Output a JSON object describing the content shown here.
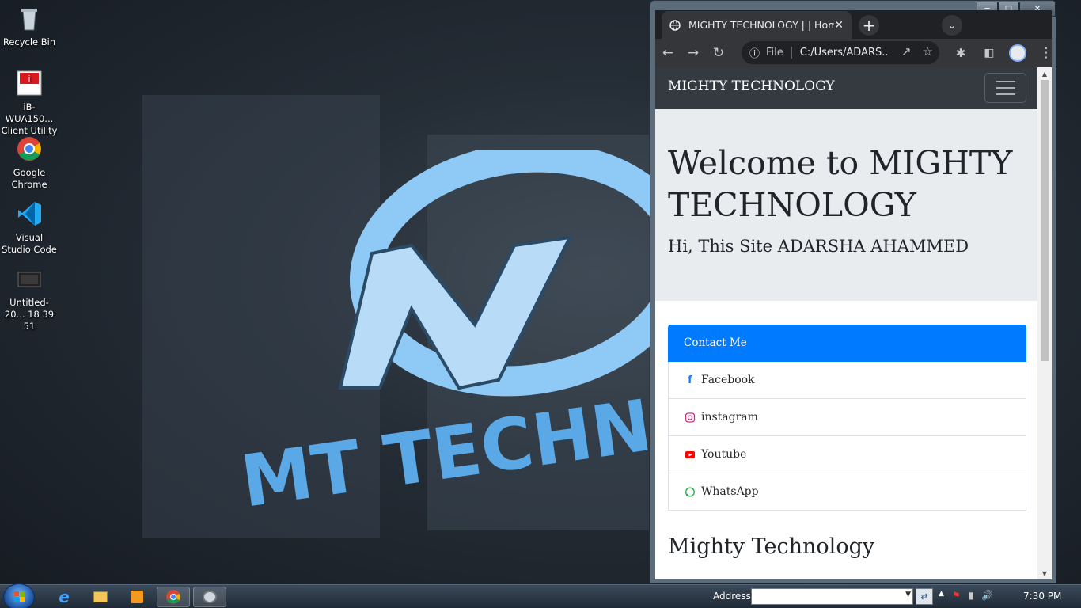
{
  "desktop": {
    "icons": [
      {
        "label": "Recycle Bin",
        "icon": "recycle-bin-icon"
      },
      {
        "label": "iB-WUA150... Client Utility",
        "icon": "client-utility-icon"
      },
      {
        "label": "Google Chrome",
        "icon": "chrome-icon"
      },
      {
        "label": "Visual Studio Code",
        "icon": "vscode-icon"
      },
      {
        "label": "Untitled-20... 18 39 51",
        "icon": "video-file-icon"
      }
    ],
    "wallpaper_text": "MT TECHN"
  },
  "browser": {
    "tab_title": "MIGHTY TECHNOLOGY | | Home",
    "omnibox_scheme": "File",
    "omnibox_url": "C:/Users/ADARS..."
  },
  "page": {
    "brand": "MIGHTY TECHNOLOGY",
    "jumbotron_title": "Welcome to MIGHTY TECHNOLOGY",
    "jumbotron_lead": "Hi, This Site ADARSHA AHAMMED",
    "contact_header": "Contact Me",
    "contacts": [
      {
        "label": "Facebook",
        "icon": "facebook-icon",
        "color": "#1877f2"
      },
      {
        "label": "instagram",
        "icon": "instagram-icon",
        "color": "#c13584"
      },
      {
        "label": "Youtube",
        "icon": "youtube-icon",
        "color": "#ff0000"
      },
      {
        "label": "WhatsApp",
        "icon": "whatsapp-icon",
        "color": "#25d366"
      }
    ],
    "section_title": "Mighty Technology"
  },
  "taskbar": {
    "address_label": "Address",
    "address_value": "",
    "clock": "7:30 PM"
  },
  "colors": {
    "navbar": "#343a40",
    "jumbotron": "#e9ecef",
    "active": "#007bff"
  }
}
